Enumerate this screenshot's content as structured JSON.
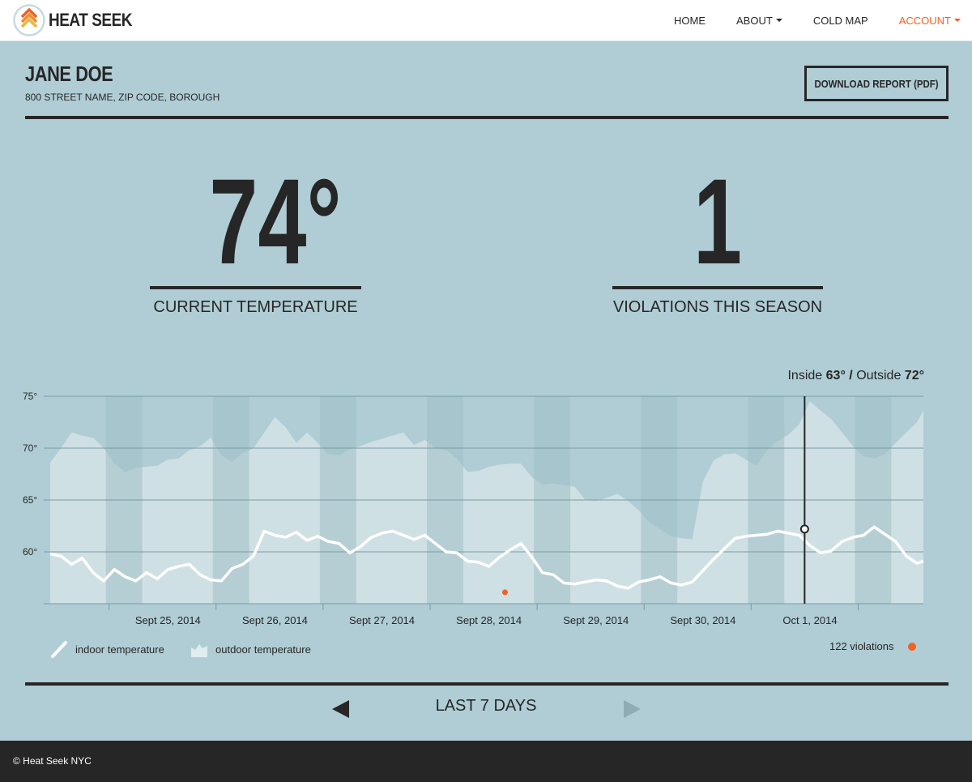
{
  "header": {
    "brand": "HEAT SEEK",
    "nav": [
      {
        "label": "HOME",
        "dropdown": false
      },
      {
        "label": "ABOUT",
        "dropdown": true
      },
      {
        "label": "COLD MAP",
        "dropdown": false
      },
      {
        "label": "ACCOUNT",
        "dropdown": true
      }
    ]
  },
  "profile": {
    "name": "JANE DOE",
    "address": "800 STREET NAME, ZIP CODE, BOROUGH",
    "download_label": "DOWNLOAD REPORT (PDF)"
  },
  "stats": {
    "current_temperature": "74°",
    "current_temperature_label": "CURRENT TEMPERATURE",
    "violations": "1",
    "violations_label": "VIOLATIONS THIS SEASON"
  },
  "readout": {
    "inside_label": "Inside",
    "inside_value": "63°",
    "separator": "/",
    "outside_label": "Outside",
    "outside_value": "72°"
  },
  "chart_data": {
    "type": "area",
    "y_ticks": [
      "75°",
      "70°",
      "65°",
      "60°"
    ],
    "y_tick_values": [
      75,
      70,
      65,
      60
    ],
    "ylim": [
      55,
      76
    ],
    "x_tick_labels": [
      "Sept 25, 2014",
      "Sept 26, 2014",
      "Sept 27, 2014",
      "Sept 28, 2014",
      "Sept 29, 2014",
      "Sept 30, 2014",
      "Oct 1, 2014"
    ],
    "x_tick_day_positions": [
      0.55,
      1.55,
      2.55,
      3.55,
      4.55,
      5.55,
      6.55
    ],
    "x_range_days": [
      -0.55,
      7.61
    ],
    "night_bands_days": [
      [
        -0.03,
        0.31
      ],
      [
        0.97,
        1.31
      ],
      [
        1.97,
        2.31
      ],
      [
        2.97,
        3.31
      ],
      [
        3.97,
        4.31
      ],
      [
        4.97,
        5.31
      ],
      [
        5.97,
        6.31
      ],
      [
        6.97,
        7.31
      ]
    ],
    "grid": true,
    "series": [
      {
        "name": "outdoor temperature",
        "color": "#cfe0e4",
        "x_days": [
          -0.55,
          -0.45,
          -0.35,
          -0.25,
          -0.15,
          -0.05,
          0.05,
          0.15,
          0.25,
          0.35,
          0.45,
          0.55,
          0.65,
          0.75,
          0.85,
          0.95,
          1.05,
          1.15,
          1.25,
          1.35,
          1.45,
          1.55,
          1.65,
          1.75,
          1.85,
          1.95,
          2.05,
          2.15,
          2.25,
          2.35,
          2.45,
          2.55,
          2.65,
          2.75,
          2.85,
          2.95,
          3.05,
          3.15,
          3.25,
          3.35,
          3.45,
          3.55,
          3.65,
          3.75,
          3.85,
          3.95,
          4.05,
          4.15,
          4.25,
          4.35,
          4.45,
          4.55,
          4.65,
          4.75,
          4.85,
          4.95,
          5.05,
          5.15,
          5.25,
          5.35,
          5.45,
          5.55,
          5.65,
          5.75,
          5.85,
          5.95,
          6.05,
          6.15,
          6.25,
          6.35,
          6.45,
          6.55,
          6.65,
          6.75,
          6.85,
          6.95,
          7.05,
          7.15,
          7.25,
          7.35,
          7.45,
          7.55,
          7.61
        ],
        "values": [
          68.6,
          70.0,
          71.5,
          71.2,
          71.0,
          70.0,
          68.5,
          67.7,
          68.1,
          68.2,
          68.3,
          68.9,
          69.0,
          69.8,
          70.2,
          71.0,
          69.3,
          68.7,
          69.5,
          70.0,
          71.5,
          73.0,
          72.0,
          70.5,
          71.5,
          70.5,
          69.4,
          69.3,
          69.9,
          70.2,
          70.6,
          70.9,
          71.2,
          71.5,
          70.3,
          70.8,
          70.0,
          69.8,
          69.0,
          67.7,
          67.8,
          68.2,
          68.4,
          68.5,
          68.5,
          67.2,
          66.5,
          66.6,
          66.4,
          66.3,
          65.0,
          64.9,
          65.2,
          65.6,
          64.9,
          64.0,
          62.8,
          62.2,
          61.5,
          61.3,
          61.2,
          66.8,
          68.8,
          69.4,
          69.5,
          68.9,
          68.3,
          69.8,
          70.7,
          71.3,
          72.3,
          74.5,
          73.6,
          72.8,
          71.5,
          70.2,
          69.2,
          69.0,
          69.4,
          70.5,
          71.5,
          72.5,
          73.6,
          73.1,
          72.8,
          71.2,
          69.5,
          68.7,
          71.2,
          72.3,
          73.2,
          73.5,
          73.6,
          74.0
        ]
      },
      {
        "name": "indoor temperature",
        "color": "#ffffff",
        "x_days": [
          -0.55,
          -0.45,
          -0.35,
          -0.25,
          -0.15,
          -0.05,
          0.05,
          0.15,
          0.25,
          0.35,
          0.45,
          0.55,
          0.65,
          0.75,
          0.85,
          0.95,
          1.05,
          1.15,
          1.25,
          1.35,
          1.45,
          1.55,
          1.65,
          1.75,
          1.85,
          1.95,
          2.05,
          2.15,
          2.25,
          2.35,
          2.45,
          2.55,
          2.65,
          2.75,
          2.85,
          2.95,
          3.05,
          3.15,
          3.25,
          3.35,
          3.45,
          3.55,
          3.65,
          3.75,
          3.85,
          3.95,
          4.05,
          4.15,
          4.25,
          4.35,
          4.45,
          4.55,
          4.65,
          4.75,
          4.85,
          4.95,
          5.05,
          5.15,
          5.25,
          5.35,
          5.45,
          5.55,
          5.65,
          5.75,
          5.85,
          5.95,
          6.05,
          6.15,
          6.25,
          6.35,
          6.45,
          6.55,
          6.65,
          6.75,
          6.85,
          6.95,
          7.05,
          7.15,
          7.25,
          7.35,
          7.45,
          7.55,
          7.61
        ],
        "values": [
          59.8,
          59.6,
          58.8,
          59.4,
          58.0,
          57.2,
          58.3,
          57.6,
          57.2,
          58.0,
          57.4,
          58.3,
          58.6,
          58.8,
          57.8,
          57.3,
          57.2,
          58.4,
          58.8,
          59.6,
          62.0,
          61.6,
          61.4,
          61.9,
          61.1,
          61.5,
          61.0,
          60.8,
          59.9,
          60.5,
          61.4,
          61.8,
          62.0,
          61.6,
          61.2,
          61.6,
          60.8,
          60.0,
          59.9,
          59.1,
          59.0,
          58.6,
          59.5,
          60.2,
          60.8,
          59.5,
          58.0,
          57.8,
          57.0,
          56.9,
          57.1,
          57.3,
          57.2,
          56.7,
          56.5,
          57.1,
          57.3,
          57.6,
          57.0,
          56.8,
          57.1,
          58.2,
          59.3,
          60.3,
          61.3,
          61.5,
          61.6,
          61.7,
          62.0,
          61.8,
          61.6,
          60.6,
          59.9,
          60.1,
          61.0,
          61.4,
          61.6,
          62.4,
          61.7,
          61.0,
          59.6,
          58.9,
          59.1,
          59.8,
          60.4,
          61.2,
          61.5,
          61.4,
          61.6,
          61.4
        ]
      }
    ],
    "violation_points": [
      {
        "x_day": 3.7,
        "value": 56.1
      }
    ],
    "cursor": {
      "x_day": 6.5,
      "inside": 63,
      "outside": 72
    },
    "legend": {
      "indoor": "indoor temperature",
      "outdoor": "outdoor temperature",
      "violations": "122 violations"
    }
  },
  "pager": {
    "label": "LAST 7 DAYS",
    "prev": "previous",
    "next": "next"
  },
  "colors": {
    "background": "#b0cdd5",
    "dark": "#262626",
    "accent": "#f26122",
    "night_band": "#a1bfc6",
    "outdoor_fill": "#cfe0e4"
  },
  "footer": {
    "copyright": "© Heat Seek NYC"
  }
}
